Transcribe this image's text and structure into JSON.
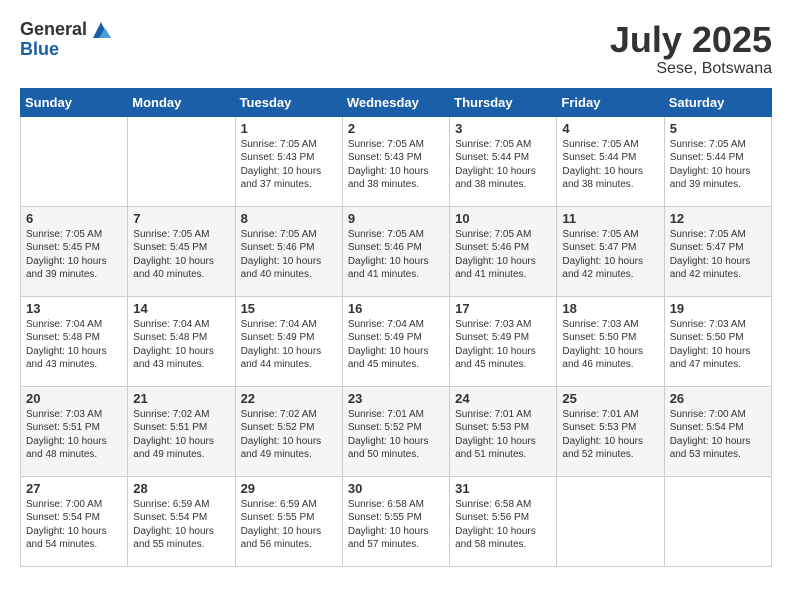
{
  "header": {
    "logo_general": "General",
    "logo_blue": "Blue",
    "month_title": "July 2025",
    "location": "Sese, Botswana"
  },
  "columns": [
    "Sunday",
    "Monday",
    "Tuesday",
    "Wednesday",
    "Thursday",
    "Friday",
    "Saturday"
  ],
  "weeks": [
    [
      {
        "day": "",
        "content": ""
      },
      {
        "day": "",
        "content": ""
      },
      {
        "day": "1",
        "content": "Sunrise: 7:05 AM\nSunset: 5:43 PM\nDaylight: 10 hours and 37 minutes."
      },
      {
        "day": "2",
        "content": "Sunrise: 7:05 AM\nSunset: 5:43 PM\nDaylight: 10 hours and 38 minutes."
      },
      {
        "day": "3",
        "content": "Sunrise: 7:05 AM\nSunset: 5:44 PM\nDaylight: 10 hours and 38 minutes."
      },
      {
        "day": "4",
        "content": "Sunrise: 7:05 AM\nSunset: 5:44 PM\nDaylight: 10 hours and 38 minutes."
      },
      {
        "day": "5",
        "content": "Sunrise: 7:05 AM\nSunset: 5:44 PM\nDaylight: 10 hours and 39 minutes."
      }
    ],
    [
      {
        "day": "6",
        "content": "Sunrise: 7:05 AM\nSunset: 5:45 PM\nDaylight: 10 hours and 39 minutes."
      },
      {
        "day": "7",
        "content": "Sunrise: 7:05 AM\nSunset: 5:45 PM\nDaylight: 10 hours and 40 minutes."
      },
      {
        "day": "8",
        "content": "Sunrise: 7:05 AM\nSunset: 5:46 PM\nDaylight: 10 hours and 40 minutes."
      },
      {
        "day": "9",
        "content": "Sunrise: 7:05 AM\nSunset: 5:46 PM\nDaylight: 10 hours and 41 minutes."
      },
      {
        "day": "10",
        "content": "Sunrise: 7:05 AM\nSunset: 5:46 PM\nDaylight: 10 hours and 41 minutes."
      },
      {
        "day": "11",
        "content": "Sunrise: 7:05 AM\nSunset: 5:47 PM\nDaylight: 10 hours and 42 minutes."
      },
      {
        "day": "12",
        "content": "Sunrise: 7:05 AM\nSunset: 5:47 PM\nDaylight: 10 hours and 42 minutes."
      }
    ],
    [
      {
        "day": "13",
        "content": "Sunrise: 7:04 AM\nSunset: 5:48 PM\nDaylight: 10 hours and 43 minutes."
      },
      {
        "day": "14",
        "content": "Sunrise: 7:04 AM\nSunset: 5:48 PM\nDaylight: 10 hours and 43 minutes."
      },
      {
        "day": "15",
        "content": "Sunrise: 7:04 AM\nSunset: 5:49 PM\nDaylight: 10 hours and 44 minutes."
      },
      {
        "day": "16",
        "content": "Sunrise: 7:04 AM\nSunset: 5:49 PM\nDaylight: 10 hours and 45 minutes."
      },
      {
        "day": "17",
        "content": "Sunrise: 7:03 AM\nSunset: 5:49 PM\nDaylight: 10 hours and 45 minutes."
      },
      {
        "day": "18",
        "content": "Sunrise: 7:03 AM\nSunset: 5:50 PM\nDaylight: 10 hours and 46 minutes."
      },
      {
        "day": "19",
        "content": "Sunrise: 7:03 AM\nSunset: 5:50 PM\nDaylight: 10 hours and 47 minutes."
      }
    ],
    [
      {
        "day": "20",
        "content": "Sunrise: 7:03 AM\nSunset: 5:51 PM\nDaylight: 10 hours and 48 minutes."
      },
      {
        "day": "21",
        "content": "Sunrise: 7:02 AM\nSunset: 5:51 PM\nDaylight: 10 hours and 49 minutes."
      },
      {
        "day": "22",
        "content": "Sunrise: 7:02 AM\nSunset: 5:52 PM\nDaylight: 10 hours and 49 minutes."
      },
      {
        "day": "23",
        "content": "Sunrise: 7:01 AM\nSunset: 5:52 PM\nDaylight: 10 hours and 50 minutes."
      },
      {
        "day": "24",
        "content": "Sunrise: 7:01 AM\nSunset: 5:53 PM\nDaylight: 10 hours and 51 minutes."
      },
      {
        "day": "25",
        "content": "Sunrise: 7:01 AM\nSunset: 5:53 PM\nDaylight: 10 hours and 52 minutes."
      },
      {
        "day": "26",
        "content": "Sunrise: 7:00 AM\nSunset: 5:54 PM\nDaylight: 10 hours and 53 minutes."
      }
    ],
    [
      {
        "day": "27",
        "content": "Sunrise: 7:00 AM\nSunset: 5:54 PM\nDaylight: 10 hours and 54 minutes."
      },
      {
        "day": "28",
        "content": "Sunrise: 6:59 AM\nSunset: 5:54 PM\nDaylight: 10 hours and 55 minutes."
      },
      {
        "day": "29",
        "content": "Sunrise: 6:59 AM\nSunset: 5:55 PM\nDaylight: 10 hours and 56 minutes."
      },
      {
        "day": "30",
        "content": "Sunrise: 6:58 AM\nSunset: 5:55 PM\nDaylight: 10 hours and 57 minutes."
      },
      {
        "day": "31",
        "content": "Sunrise: 6:58 AM\nSunset: 5:56 PM\nDaylight: 10 hours and 58 minutes."
      },
      {
        "day": "",
        "content": ""
      },
      {
        "day": "",
        "content": ""
      }
    ]
  ]
}
